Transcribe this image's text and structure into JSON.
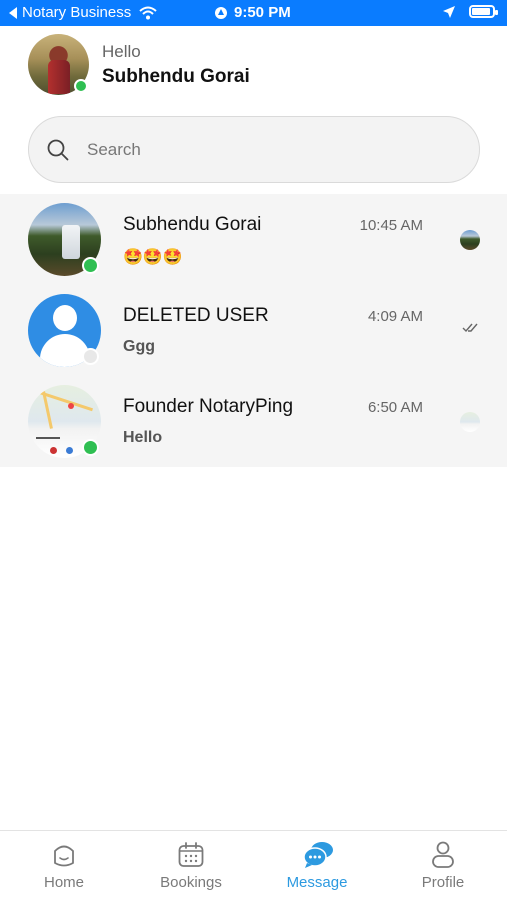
{
  "status_bar": {
    "back_app": "Notary Business",
    "time": "9:50 PM"
  },
  "header": {
    "greeting": "Hello",
    "user_name": "Subhendu Gorai"
  },
  "search": {
    "placeholder": "Search"
  },
  "chats": [
    {
      "name": "Subhendu Gorai",
      "message": "🤩🤩🤩",
      "time": "10:45 AM",
      "online": true
    },
    {
      "name": "DELETED USER",
      "message": "Ggg",
      "time": "4:09 AM",
      "online": false
    },
    {
      "name": "Founder NotaryPing",
      "message": "Hello",
      "time": "6:50 AM",
      "online": true
    }
  ],
  "tabs": [
    {
      "label": "Home",
      "icon": "home-icon",
      "active": false
    },
    {
      "label": "Bookings",
      "icon": "calendar-icon",
      "active": false
    },
    {
      "label": "Message",
      "icon": "chat-bubbles-icon",
      "active": true
    },
    {
      "label": "Profile",
      "icon": "person-icon",
      "active": false
    }
  ],
  "colors": {
    "status_bar": "#0a7cff",
    "online": "#2fbf52",
    "active_tab": "#2d9ae0",
    "list_bg": "#f5f5f5"
  }
}
